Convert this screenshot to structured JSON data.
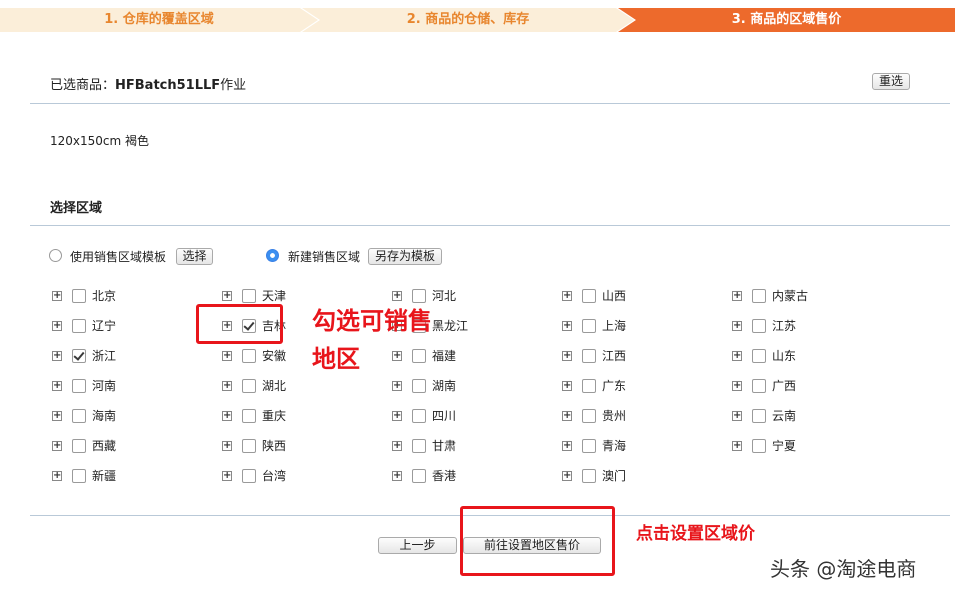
{
  "steps": [
    {
      "label": "1. 仓库的覆盖区域"
    },
    {
      "label": "2. 商品的仓储、库存"
    },
    {
      "label": "3. 商品的区域售价"
    }
  ],
  "selected": {
    "prefix": "已选商品：",
    "name": "HFBatch51LLF",
    "suffix": "作业",
    "reset_label": "重选"
  },
  "spec": "120x150cm 褐色",
  "section_title": "选择区域",
  "mode": {
    "template_label": "使用销售区域模板",
    "choose_label": "选择",
    "new_label": "新建销售区域",
    "save_as_label": "另存为模板"
  },
  "regions": [
    [
      "北京",
      "天津",
      "河北",
      "山西",
      "内蒙古"
    ],
    [
      "辽宁",
      "吉林",
      "黑龙江",
      "上海",
      "江苏"
    ],
    [
      "浙江",
      "安徽",
      "福建",
      "江西",
      "山东"
    ],
    [
      "河南",
      "湖北",
      "湖南",
      "广东",
      "广西"
    ],
    [
      "海南",
      "重庆",
      "四川",
      "贵州",
      "云南"
    ],
    [
      "西藏",
      "陕西",
      "甘肃",
      "青海",
      "宁夏"
    ],
    [
      "新疆",
      "台湾",
      "香港",
      "澳门"
    ]
  ],
  "checked_regions": [
    "吉林",
    "浙江"
  ],
  "buttons": {
    "prev_label": "上一步",
    "go_label": "前往设置地区售价"
  },
  "annotations": {
    "check_tip": "勾选可销售地区",
    "click_tip": "点击设置区域价"
  },
  "watermark": "头条 @淘途电商"
}
